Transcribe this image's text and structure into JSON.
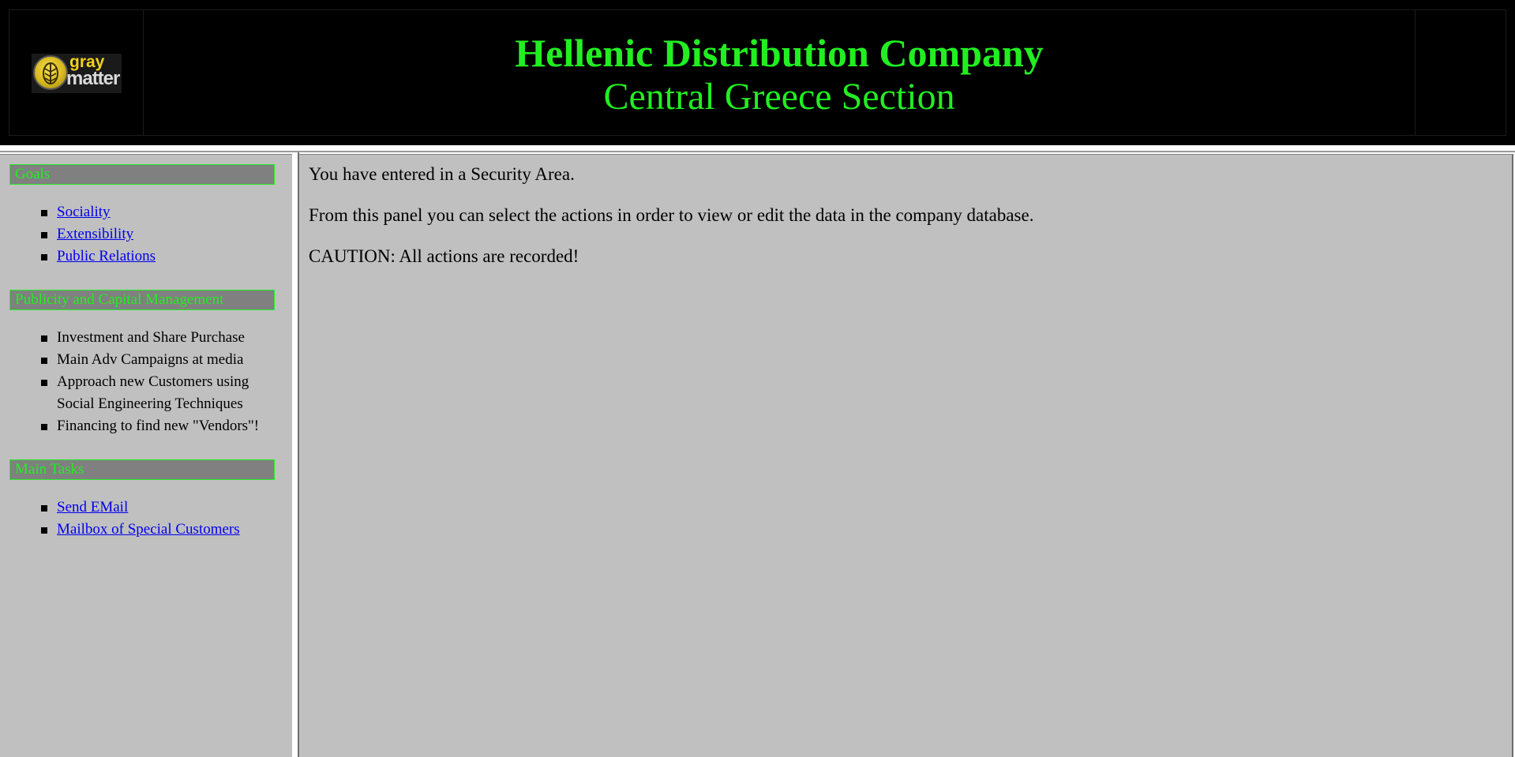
{
  "header": {
    "logo": {
      "line1": "gray",
      "line2": "matter"
    },
    "title": "Hellenic Distribution Company",
    "subtitle": "Central Greece Section"
  },
  "sidebar": {
    "sections": [
      {
        "heading": "Goals",
        "items": [
          {
            "label": "Sociality",
            "link": true
          },
          {
            "label": "Extensibility",
            "link": true
          },
          {
            "label": "Public Relations",
            "link": true
          }
        ]
      },
      {
        "heading": "Publicity and Capital Management",
        "items": [
          {
            "label": "Investment and Share Purchase",
            "link": false
          },
          {
            "label": "Main Adv Campaigns at media",
            "link": false
          },
          {
            "label": "Approach new Customers using Social Engineering Techniques",
            "link": false
          },
          {
            "label": "Financing to find new \"Vendors\"!",
            "link": false
          }
        ]
      },
      {
        "heading": "Main Tasks",
        "items": [
          {
            "label": "Send EMail",
            "link": true
          },
          {
            "label": "Mailbox of Special Customers",
            "link": true
          }
        ]
      }
    ]
  },
  "main": {
    "messages": [
      "You have entered in a Security Area.",
      "From this panel you can select the actions in order to view or edit the data in the company database.",
      "CAUTION: All actions are recorded!"
    ]
  },
  "colors": {
    "accent_green": "#22ee22",
    "panel_gray": "#c0c0c0",
    "header_bg": "#000000",
    "link_blue": "#0000ee"
  }
}
